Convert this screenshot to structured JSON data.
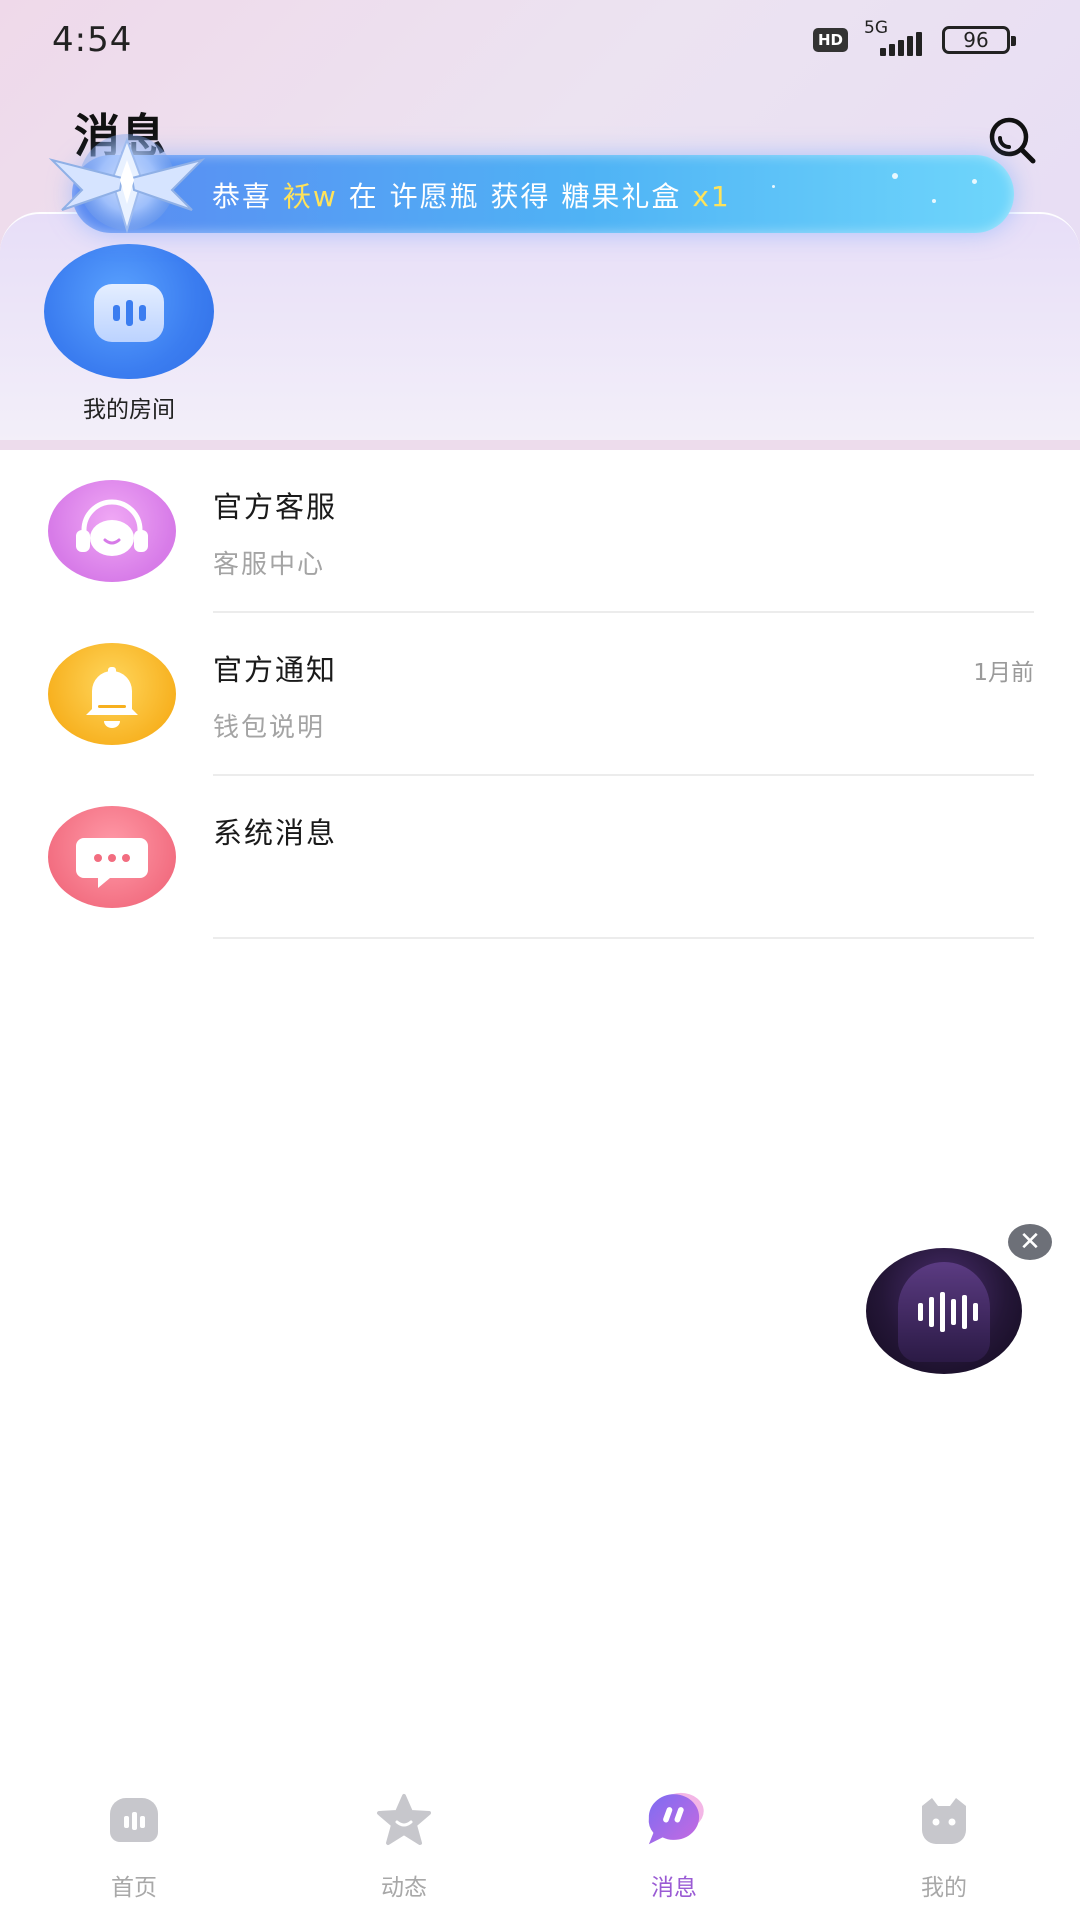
{
  "status_bar": {
    "time": "4:54",
    "hd_label": "HD",
    "network_label": "5G",
    "battery_level": "96"
  },
  "header": {
    "title": "消息",
    "search_icon": "search-icon"
  },
  "banner": {
    "prefix": "恭喜 ",
    "user": "袄w",
    "middle": " 在 许愿瓶 获得 糖果礼盒 ",
    "count": "x1",
    "colors": {
      "text": "#ffffff",
      "highlight": "#ffe35a"
    }
  },
  "room": {
    "label": "我的房间",
    "icon": "voice-room-icon"
  },
  "messages": [
    {
      "title": "官方客服",
      "subtitle": "客服中心",
      "time": "",
      "icon": "headset-avatar-icon"
    },
    {
      "title": "官方通知",
      "subtitle": "钱包说明",
      "time": "1月前",
      "icon": "bell-avatar-icon"
    },
    {
      "title": "系统消息",
      "subtitle": "",
      "time": "",
      "icon": "chat-bubble-avatar-icon"
    }
  ],
  "float_room": {
    "close_label": "✕",
    "icon": "audio-wave-icon"
  },
  "bottom_nav": {
    "active_color": "#9a5bd4",
    "items": [
      {
        "label": "首页",
        "icon": "home-icon",
        "active": false
      },
      {
        "label": "动态",
        "icon": "star-icon",
        "active": false
      },
      {
        "label": "消息",
        "icon": "message-icon",
        "active": true
      },
      {
        "label": "我的",
        "icon": "profile-icon",
        "active": false
      }
    ]
  }
}
